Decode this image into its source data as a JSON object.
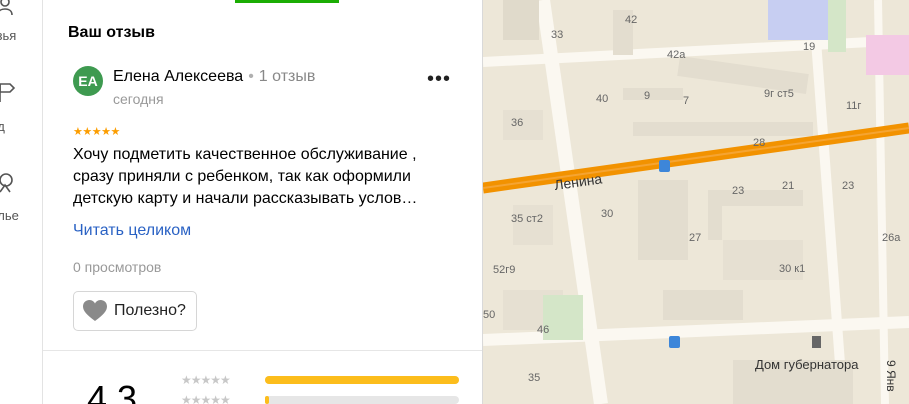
{
  "rail": {
    "items": [
      {
        "label": "узья",
        "icon": "friends-icon"
      },
      {
        "label": "ид",
        "icon": "guide-icon"
      },
      {
        "label": "алье",
        "icon": "portfolio-icon"
      }
    ]
  },
  "review_form": {
    "title": "Ваш отзыв"
  },
  "review": {
    "avatar_initials": "ЕА",
    "avatar_color": "#3e9a50",
    "author": "Елена Алексеева",
    "separator": "•",
    "author_reviews": "1 отзыв",
    "date": "сегодня",
    "stars": "★★★★★",
    "rating": 5,
    "text": "Хочу подметить качественное обслуживание , сразу приняли с ребенком, так как оформили детскую карту и начали рассказывать услов…",
    "read_more": "Читать целиком",
    "views": "0 просмотров",
    "useful_label": "Полезно?"
  },
  "rating_summary": {
    "value": "4,3",
    "rows": [
      {
        "stars": "★★★★★",
        "fill": 1.0
      },
      {
        "stars": "★★★★★",
        "fill": 0.02
      }
    ]
  },
  "map": {
    "street_label": "Ленина",
    "landmark_label": "Дом губернатора",
    "vertical_street_label": "9 Янв",
    "building_numbers": [
      "33",
      "42",
      "19",
      "42а",
      "9г ст5",
      "40",
      "9",
      "7",
      "11г",
      "36",
      "28",
      "23",
      "21",
      "23",
      "35 ст2",
      "30",
      "27",
      "30 к1",
      "26а",
      "52г9",
      "46",
      "50",
      "35"
    ],
    "accent_colors": {
      "road": "#f29200",
      "bus_stop": "#3d86d9",
      "park": "#d4e6c8",
      "block": "#fbf8f1"
    }
  }
}
